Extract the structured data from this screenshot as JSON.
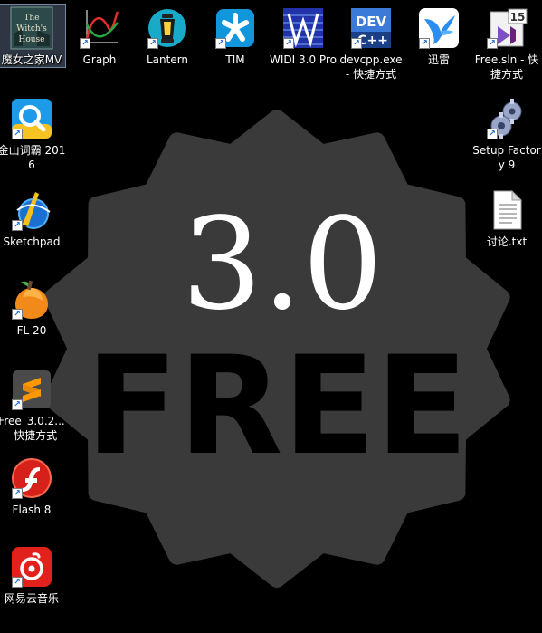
{
  "desktop": {
    "wallpaper": {
      "number": "3.0",
      "word": "FREE",
      "badge_color": "#3a3a3a"
    },
    "icons": [
      {
        "label": "魔女之家MV",
        "image_text": "The Witch's House"
      },
      {
        "label": "Graph"
      },
      {
        "label": "Lantern"
      },
      {
        "label": "TIM"
      },
      {
        "label": "WIDI 3.0 Pro"
      },
      {
        "label": "devcpp.exe - 快捷方式",
        "image_text": "DEV C++"
      },
      {
        "label": "迅雷"
      },
      {
        "label": "Free.sln - 快捷方式",
        "image_text": "15"
      },
      {
        "label": "金山词霸 2016"
      },
      {
        "label": "Setup Factory 9"
      },
      {
        "label": "Sketchpad"
      },
      {
        "label": "讨论.txt"
      },
      {
        "label": "FL 20"
      },
      {
        "label": "Free_3.0.2... - 快捷方式"
      },
      {
        "label": "Flash 8"
      },
      {
        "label": "网易云音乐"
      }
    ]
  }
}
